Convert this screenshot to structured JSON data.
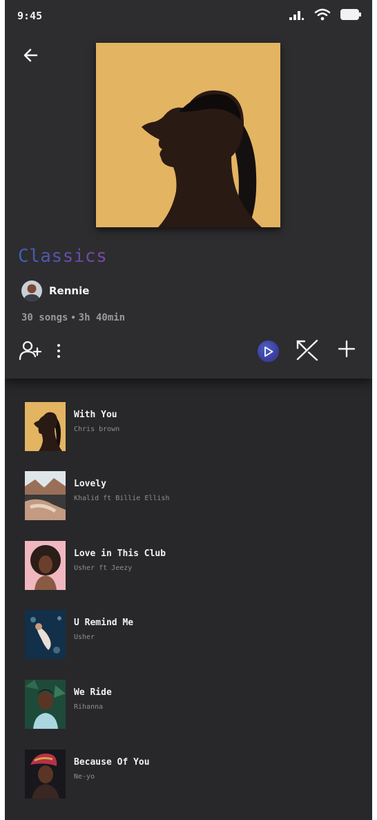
{
  "status_bar": {
    "time": "9:45"
  },
  "playlist": {
    "title": "Classics",
    "owner": "Rennie",
    "song_count": "30 songs",
    "separator": "•",
    "duration": "3h 40min"
  },
  "colors": {
    "accent_gradient_start": "#3d61b8",
    "accent_gradient_end": "#7a4aa5",
    "background": "#29292b"
  },
  "songs": [
    {
      "title": "With You",
      "artist": "Chris brown"
    },
    {
      "title": "Lovely",
      "artist": "Khalid ft Billie Ellish"
    },
    {
      "title": "Love in This Club",
      "artist": "Usher ft Jeezy"
    },
    {
      "title": "U Remind Me",
      "artist": "Usher"
    },
    {
      "title": "We Ride",
      "artist": "Rihanna"
    },
    {
      "title": "Because Of You",
      "artist": "Ne-yo"
    }
  ],
  "icons": [
    "back-arrow-icon",
    "add-user-icon",
    "more-vertical-icon",
    "play-icon",
    "shuffle-icon",
    "plus-icon",
    "signal-icon",
    "wifi-icon",
    "battery-icon"
  ]
}
